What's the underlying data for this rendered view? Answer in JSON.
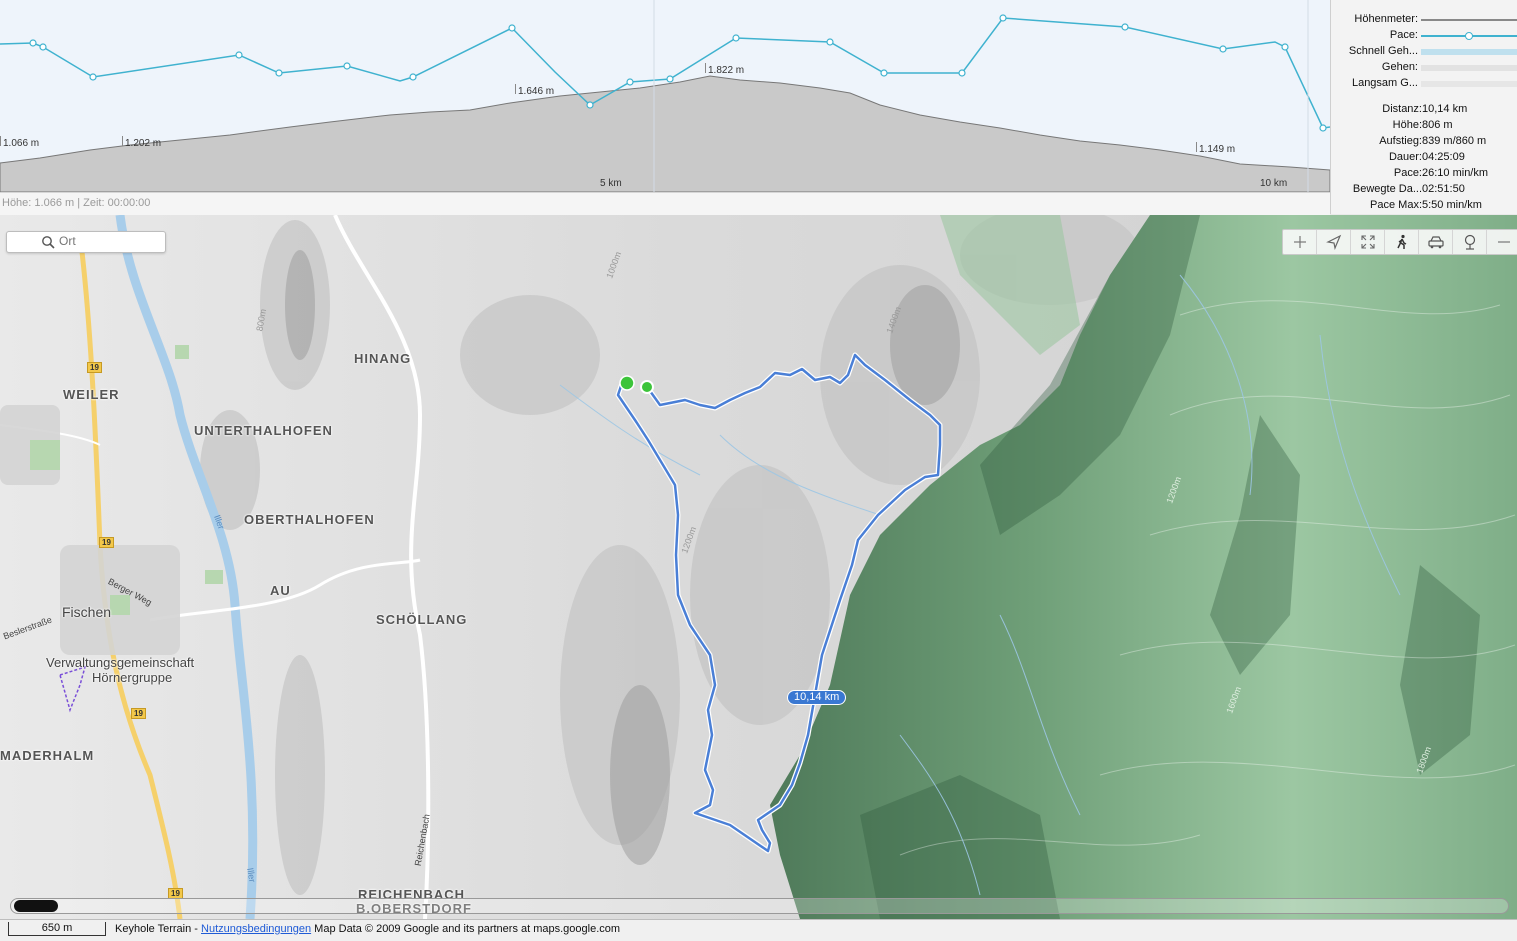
{
  "profile": {
    "elevation_labels": [
      "1.066 m",
      "1.202 m",
      "1.646 m",
      "1.822 m",
      "1.149 m"
    ],
    "x_ticks": [
      "5 km",
      "10 km"
    ],
    "status": "Höhe: 1.066 m | Zeit: 00:00:00",
    "colors": {
      "elevation_fill": "#c8c8c8",
      "pace_line": "#3fb2cf",
      "background": "#eef4fb"
    }
  },
  "legend": {
    "items": [
      {
        "label": "Höhenmeter:",
        "swatch": "line-gray"
      },
      {
        "label": "Pace:",
        "swatch": "line-blue-dot"
      },
      {
        "label": "Schnell Geh...",
        "swatch": "band-lightblue"
      },
      {
        "label": "Gehen:",
        "swatch": "band-lightgray"
      },
      {
        "label": "Langsam G...",
        "swatch": "band-lightgray"
      }
    ]
  },
  "stats": [
    {
      "key": "Distanz:",
      "value": "10,14 km"
    },
    {
      "key": "Höhe:",
      "value": "806 m"
    },
    {
      "key": "Aufstieg:",
      "value": "839 m/860 m"
    },
    {
      "key": "Dauer:",
      "value": "04:25:09"
    },
    {
      "key": "Pace:",
      "value": "26:10 min/km"
    },
    {
      "key": "Bewegte Da...",
      "value": "02:51:50"
    },
    {
      "key": "Pace Max:",
      "value": "5:50 min/km"
    }
  ],
  "search": {
    "placeholder": "Ort",
    "icon": "search-icon"
  },
  "toolbar": [
    "zoom-in-icon",
    "location-arrow-icon",
    "fullscreen-icon",
    "walking-icon",
    "car-icon",
    "satellite-icon",
    "zoom-out-icon"
  ],
  "map": {
    "places": [
      "HINANG",
      "WEILER",
      "UNTERTHALHOFEN",
      "OBERTHALHOFEN",
      "AU",
      "SCHÖLLANG",
      "MADERHALM",
      "REICHENBACH",
      "B.OBERSTDORF"
    ],
    "towns": [
      "Fischen",
      "Verwaltungsgemeinschaft",
      "Hörnergruppe"
    ],
    "road_number": "19",
    "streets": [
      "Berger Weg",
      "Beslerstraße",
      "Iller",
      "Reichenbach"
    ],
    "contours": [
      "1000m",
      "1200m",
      "1400m",
      "1600m",
      "1800m",
      "800m"
    ],
    "route_distance": "10,14 km",
    "colors": {
      "route": "#4a7fd6",
      "terrain_green": "#7fb08a",
      "road_main": "#f5d06b"
    }
  },
  "footer": {
    "scale": "650 m",
    "credit_prefix": "Keyhole Terrain - ",
    "credit_link": "Nutzungsbedingungen",
    "credit_suffix": " Map Data © 2009 Google and its partners at maps.google.com"
  }
}
